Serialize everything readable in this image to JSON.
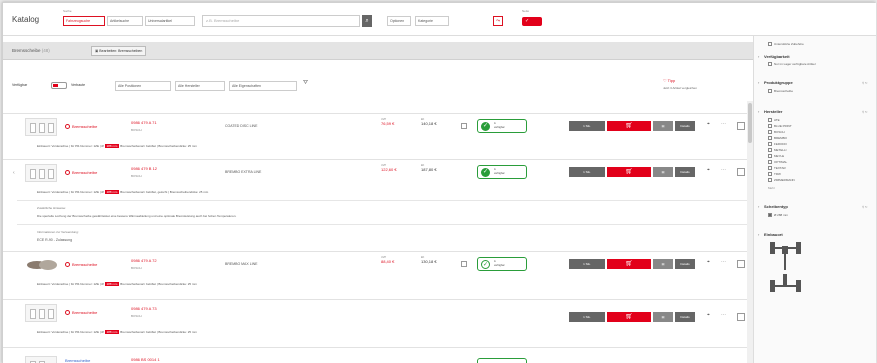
{
  "header": {
    "title": "Katalog",
    "search_label": "Suche",
    "modes": [
      "Fahrzeugsuche",
      "Artikelsuche",
      "Universalartikel"
    ],
    "search_placeholder": "z.B. Bremsscheibe",
    "options_label": "Optionen",
    "category_label": "Kategorie",
    "toggle_label": "Netto"
  },
  "tabs": {
    "active": "Bremsscheibe",
    "count": "(48)",
    "second": "Bearbeiten: Bremsscheiben"
  },
  "toolbar": {
    "view_label": "Verfügbar",
    "filter_label": "Verbaute",
    "selects": [
      "Alle Positionen",
      "Alle Hersteller",
      "Alle Eigenschaften"
    ],
    "tipp": "Tipp",
    "hint": "Jetzt 3 Artikel vergleichen",
    "colors": {
      "brand": "#e2001a",
      "ok": "#2a9d3a",
      "gray": "#666666"
    }
  },
  "results": [
    {
      "brand": "Bremsscheibe",
      "art_no": "0986 479 A 71",
      "sub_no": "BOSCH",
      "name": "COATED DISC LINE",
      "price_lbl_1": "UVP",
      "price_1": "76,59 €",
      "price_lbl_2": "EK",
      "price_2": "140,18 €",
      "stock_1": "A",
      "stock_2": "verfügbar",
      "qty": "1 Stk.",
      "btn_label": "Details",
      "attrs": "Einbauort: Vorderachse | für PR-Nummer: 1ZE | Ø",
      "tag": "288 mm",
      "attrs_tail": "Bremsscheibenart: belüftet | Bremsscheibendicke: 25 mm"
    },
    {
      "brand": "Bremsscheibe",
      "art_no": "0986 479 B 12",
      "sub_no": "BOSCH",
      "name": "BREMBO EXTRA LINE",
      "price_lbl_1": "UVP",
      "price_1": "122,60 €",
      "price_lbl_2": "EK",
      "price_2": "187,80 €",
      "stock_1": "A",
      "stock_2": "verfügbar",
      "qty": "1 Stk.",
      "btn_label": "Details",
      "attrs": "Einbauort: Vorderachse | für PR-Nummer: 1ZE | Ø",
      "tag": "288 mm",
      "attrs_tail": "Bremsscheibenart: belüftet, gelocht | Bremsscheibendicke: 25 mm",
      "note_head": "Zusätzliche Hinweise:",
      "note": "Die spezielle Lochung der Bremsscheibe gewährleistet eine bessere Wärmeableitung und eine optimale Bremsleistung auch bei hohen Temperaturen.",
      "extra_head": "Informationen zur Verwendung:",
      "extra": "ECE R-90 - Zulassung"
    },
    {
      "brand": "Bremsscheibe",
      "art_no": "0986 479 A 72",
      "sub_no": "BOSCH",
      "name": "BREMBO MAX LINE",
      "price_lbl_1": "UVP",
      "price_1": "88,40 €",
      "price_lbl_2": "EK",
      "price_2": "130,18 €",
      "stock_1": "A",
      "stock_2": "verfügbar",
      "qty": "1 Stk.",
      "btn_label": "Details",
      "attrs": "Einbauort: Vorderachse | für PR-Nummer: 1ZE | Ø",
      "tag": "288 mm",
      "attrs_tail": "Bremsscheibenart: belüftet | Bremsscheibendicke: 25 mm"
    },
    {
      "brand": "Bremsscheibe",
      "art_no": "0986 479 A 73",
      "sub_no": "BOSCH",
      "name": "",
      "qty": "1 Stk.",
      "btn_label": "Details",
      "attrs": "Einbauort: Vorderachse | für PR-Nummer: 1ZE | Ø",
      "tag": "288 mm",
      "attrs_tail": "Bremsscheibenart: belüftet | Bremsscheibendicke: 25 mm"
    },
    {
      "brand": "Bremsscheibe",
      "art_no": "0986 BS 0014 1",
      "sub_no": "",
      "name": ""
    }
  ],
  "sidebar": {
    "top_item": "Unterstützte Zubehöre",
    "sections": [
      {
        "title": "Verfügbarkeit",
        "items": [
          "Nur im Lager verfügbare Artikel"
        ]
      },
      {
        "title": "Produktgruppe",
        "items": [
          "Bremsscheibe"
        ]
      },
      {
        "title": "Hersteller",
        "items": [
          "ATE",
          "BLUE PRINT",
          "BOSCH",
          "BREMBO",
          "FERODO",
          "METELLI",
          "MEYLE",
          "OPTIMAL",
          "TEXTAR",
          "TRW",
          "ZIMMERMANN"
        ],
        "more": "Mehr"
      },
      {
        "title": "Scheibentyp",
        "items": [
          "Ø 288 mm"
        ]
      },
      {
        "title": "Einbauort",
        "items": []
      }
    ]
  }
}
